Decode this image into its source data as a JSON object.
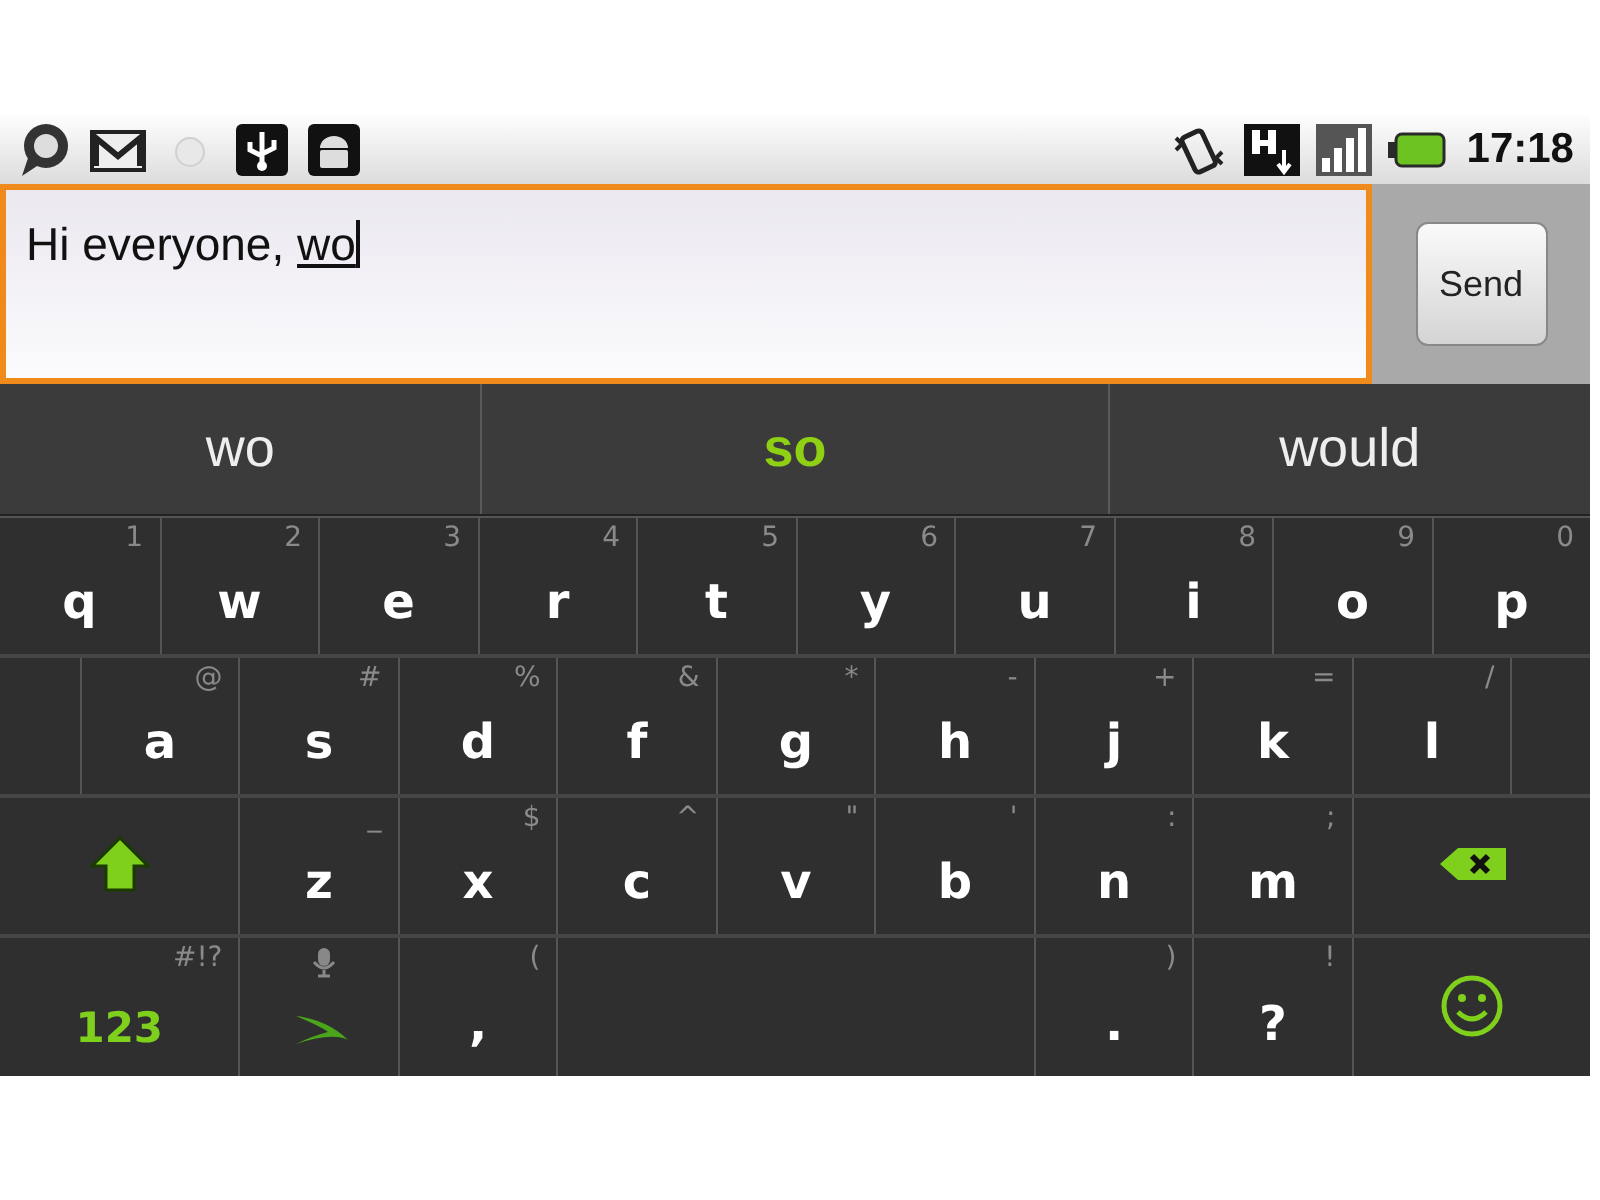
{
  "status_bar": {
    "time": "17:18"
  },
  "compose": {
    "text": "Hi everyone, ",
    "composing": "wo",
    "focused": true,
    "send_label": "Send"
  },
  "suggestions": [
    {
      "label": "wo",
      "selected": false
    },
    {
      "label": "so",
      "selected": true
    },
    {
      "label": "would",
      "selected": false
    }
  ],
  "keyboard": [
    [
      {
        "kind": "letter",
        "label": "q",
        "hint": "1"
      },
      {
        "kind": "letter",
        "label": "w",
        "hint": "2"
      },
      {
        "kind": "letter",
        "label": "e",
        "hint": "3"
      },
      {
        "kind": "letter",
        "label": "r",
        "hint": "4"
      },
      {
        "kind": "letter",
        "label": "t",
        "hint": "5"
      },
      {
        "kind": "letter",
        "label": "y",
        "hint": "6"
      },
      {
        "kind": "letter",
        "label": "u",
        "hint": "7"
      },
      {
        "kind": "letter",
        "label": "i",
        "hint": "8"
      },
      {
        "kind": "letter",
        "label": "o",
        "hint": "9"
      },
      {
        "kind": "letter",
        "label": "p",
        "hint": "0"
      }
    ],
    [
      {
        "kind": "pad"
      },
      {
        "kind": "letter",
        "label": "a",
        "hint": "@"
      },
      {
        "kind": "letter",
        "label": "s",
        "hint": "#"
      },
      {
        "kind": "letter",
        "label": "d",
        "hint": "%"
      },
      {
        "kind": "letter",
        "label": "f",
        "hint": "&"
      },
      {
        "kind": "letter",
        "label": "g",
        "hint": "*"
      },
      {
        "kind": "letter",
        "label": "h",
        "hint": "-"
      },
      {
        "kind": "letter",
        "label": "j",
        "hint": "+"
      },
      {
        "kind": "letter",
        "label": "k",
        "hint": "="
      },
      {
        "kind": "letter",
        "label": "l",
        "hint": "/"
      },
      {
        "kind": "pad"
      }
    ],
    [
      {
        "kind": "shift"
      },
      {
        "kind": "letter",
        "label": "z",
        "hint": "_"
      },
      {
        "kind": "letter",
        "label": "x",
        "hint": "$"
      },
      {
        "kind": "letter",
        "label": "c",
        "hint": "^"
      },
      {
        "kind": "letter",
        "label": "v",
        "hint": "\""
      },
      {
        "kind": "letter",
        "label": "b",
        "hint": "'"
      },
      {
        "kind": "letter",
        "label": "n",
        "hint": ":"
      },
      {
        "kind": "letter",
        "label": "m",
        "hint": ";"
      },
      {
        "kind": "backspace"
      }
    ],
    [
      {
        "kind": "symbols",
        "label": "123",
        "hint": "#!?"
      },
      {
        "kind": "swype"
      },
      {
        "kind": "letter",
        "label": ",",
        "hint": "("
      },
      {
        "kind": "space"
      },
      {
        "kind": "letter",
        "label": ".",
        "hint": ")"
      },
      {
        "kind": "letter",
        "label": "?",
        "hint": "!"
      },
      {
        "kind": "emoji"
      }
    ]
  ]
}
